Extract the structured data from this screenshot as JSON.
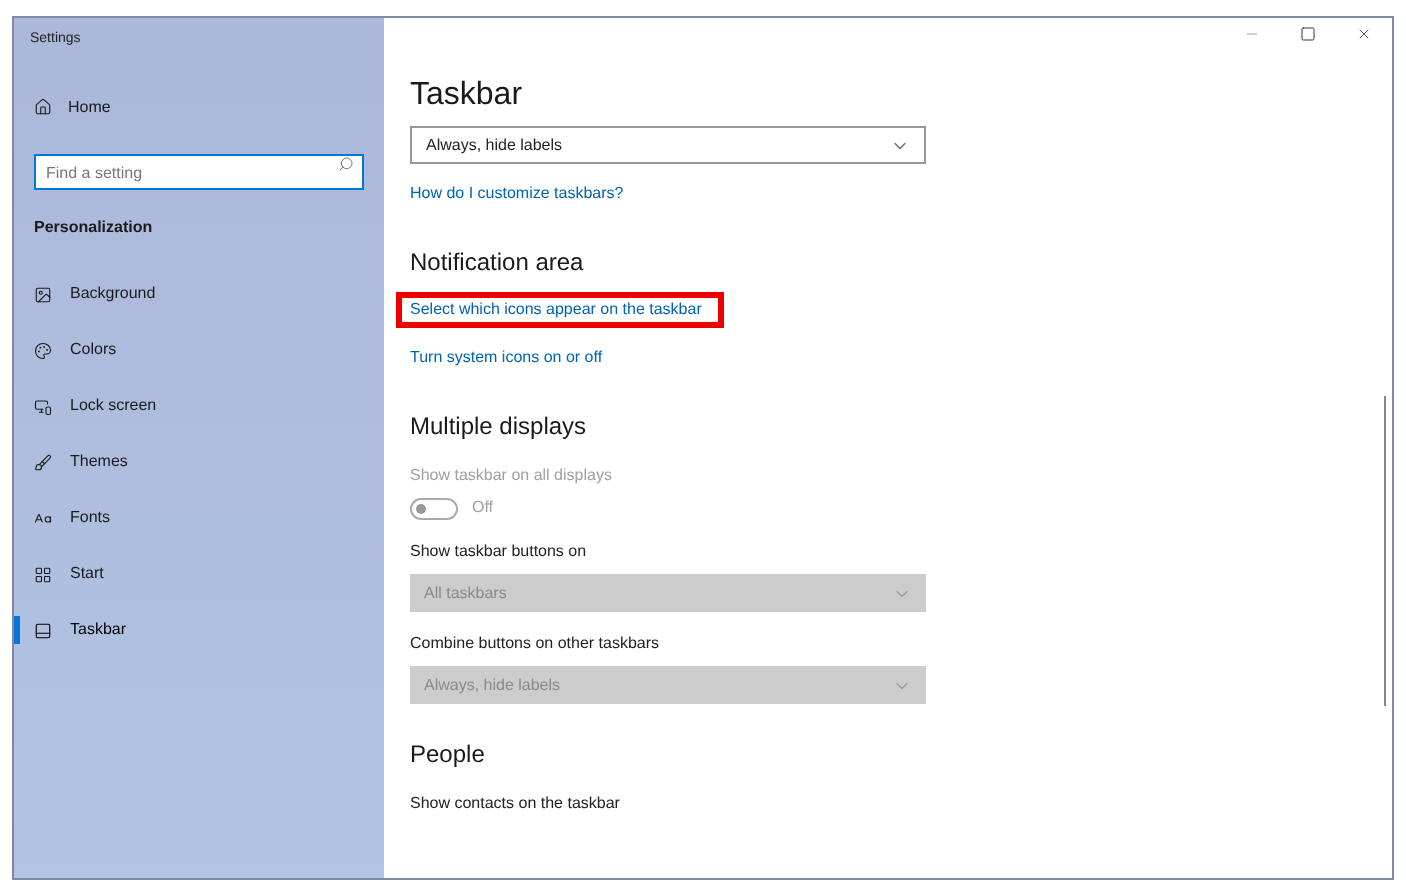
{
  "window": {
    "title": "Settings"
  },
  "sidebar": {
    "home": "Home",
    "search": {
      "placeholder": "Find a setting"
    },
    "section": "Personalization",
    "items": [
      {
        "label": "Background",
        "selected": false
      },
      {
        "label": "Colors",
        "selected": false
      },
      {
        "label": "Lock screen",
        "selected": false
      },
      {
        "label": "Themes",
        "selected": false
      },
      {
        "label": "Fonts",
        "selected": false
      },
      {
        "label": "Start",
        "selected": false
      },
      {
        "label": "Taskbar",
        "selected": true
      }
    ]
  },
  "page": {
    "title": "Taskbar",
    "blocks": [
      {
        "kind": "dropdown",
        "value": "Always, hide labels",
        "disabled": false
      },
      {
        "kind": "link",
        "text": "How do I customize taskbars?",
        "highlighted": false
      },
      {
        "kind": "heading",
        "text": "Notification area"
      },
      {
        "kind": "link",
        "text": "Select which icons appear on the taskbar",
        "highlighted": true
      },
      {
        "kind": "link",
        "text": "Turn system icons on or off",
        "highlighted": false
      },
      {
        "kind": "heading",
        "text": "Multiple displays"
      },
      {
        "kind": "label",
        "text": "Show taskbar on all displays",
        "disabled": true
      },
      {
        "kind": "toggle",
        "on": false,
        "disabled": true,
        "text": "Off"
      },
      {
        "kind": "label",
        "text": "Show taskbar buttons on",
        "disabled": false
      },
      {
        "kind": "dropdown",
        "value": "All taskbars",
        "disabled": true
      },
      {
        "kind": "label",
        "text": "Combine buttons on other taskbars",
        "disabled": false
      },
      {
        "kind": "dropdown",
        "value": "Always, hide labels",
        "disabled": true
      },
      {
        "kind": "heading",
        "text": "People"
      },
      {
        "kind": "label",
        "text": "Show contacts on the taskbar",
        "disabled": false
      }
    ]
  }
}
